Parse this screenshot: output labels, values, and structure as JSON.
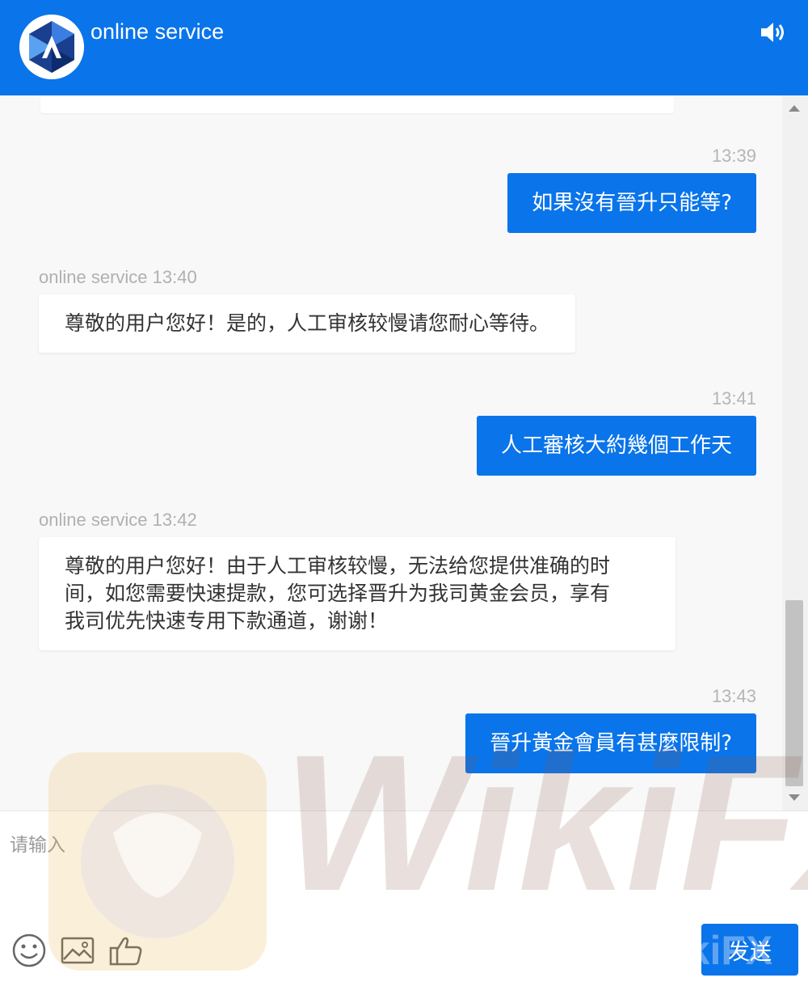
{
  "header": {
    "title": "online service",
    "avatar_icon": "logo-icon",
    "sound_icon": "speaker-icon"
  },
  "messages": [
    {
      "type": "user",
      "time": "13:39",
      "text": "如果沒有晉升只能等?"
    },
    {
      "type": "agent",
      "sender": "online service",
      "time": "13:40",
      "text": "尊敬的用户您好！是的，人工审核较慢请您耐心等待。"
    },
    {
      "type": "user",
      "time": "13:41",
      "text": "人工審核大約幾個工作天"
    },
    {
      "type": "agent",
      "sender": "online service",
      "time": "13:42",
      "lines": [
        "尊敬的用户您好！由于人工审核较慢，无法给您提供准确的时",
        "间，如您需要快速提款，您可选择晋升为我司黄金会员，享有",
        "我司优先快速专用下款通道，谢谢！"
      ]
    },
    {
      "type": "user",
      "time": "13:43",
      "text": "晉升黃金會員有甚麼限制?"
    }
  ],
  "input": {
    "placeholder": "请输入",
    "value": ""
  },
  "toolbar": {
    "emoji_icon": "emoji-icon",
    "image_icon": "image-icon",
    "like_icon": "thumbs-up-icon",
    "send_label": "发送"
  },
  "colors": {
    "primary": "#0a74ea",
    "chat_background": "#f8f8f8",
    "timestamp": "#b5b5b5"
  },
  "watermark": "WikiFX"
}
